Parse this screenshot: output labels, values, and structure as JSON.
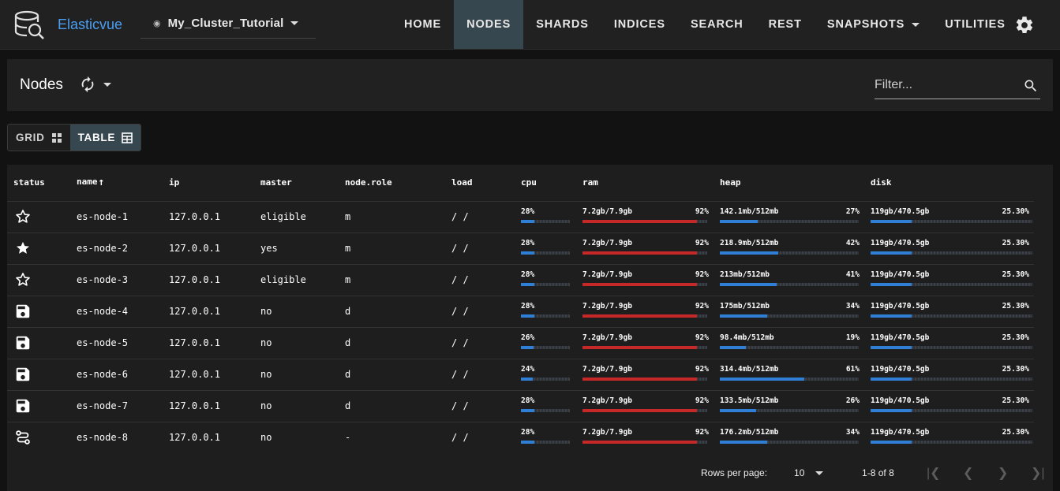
{
  "app": {
    "brand": "Elasticvue",
    "cluster_name": "My_Cluster_Tutorial",
    "accent_color": "#4a9ef2"
  },
  "nav": {
    "home": "HOME",
    "nodes": "NODES",
    "shards": "SHARDS",
    "indices": "INDICES",
    "search": "SEARCH",
    "rest": "REST",
    "snapshots": "SNAPSHOTS",
    "utilities": "UTILITIES",
    "active": "NODES",
    "settings_icon": "gear-icon"
  },
  "page": {
    "title": "Nodes",
    "filter_placeholder": "Filter..."
  },
  "view_toggle": {
    "grid": "GRID",
    "table": "TABLE",
    "active": "TABLE"
  },
  "table": {
    "columns": {
      "status": "status",
      "name": "name",
      "ip": "ip",
      "master": "master",
      "node_role": "node.role",
      "load": "load",
      "cpu": "cpu",
      "ram": "ram",
      "heap": "heap",
      "disk": "disk"
    },
    "sort": {
      "column": "name",
      "direction": "ascending"
    },
    "rows": [
      {
        "status_icon": "star-outline-icon",
        "name": "es-node-1",
        "ip": "127.0.0.1",
        "master": "eligible",
        "role": "m",
        "load": "/ /",
        "cpu": "28%",
        "cpu_pct": 28,
        "ram": "7.2gb/7.9gb",
        "ram_pct_label": "92%",
        "ram_pct": 92,
        "heap": "142.1mb/512mb",
        "heap_pct_label": "27%",
        "heap_pct": 27,
        "disk": "119gb/470.5gb",
        "disk_pct_label": "25.30%",
        "disk_pct": 25.3
      },
      {
        "status_icon": "star-filled-icon",
        "name": "es-node-2",
        "ip": "127.0.0.1",
        "master": "yes",
        "role": "m",
        "load": "/ /",
        "cpu": "28%",
        "cpu_pct": 28,
        "ram": "7.2gb/7.9gb",
        "ram_pct_label": "92%",
        "ram_pct": 92,
        "heap": "218.9mb/512mb",
        "heap_pct_label": "42%",
        "heap_pct": 42,
        "disk": "119gb/470.5gb",
        "disk_pct_label": "25.30%",
        "disk_pct": 25.3
      },
      {
        "status_icon": "star-outline-icon",
        "name": "es-node-3",
        "ip": "127.0.0.1",
        "master": "eligible",
        "role": "m",
        "load": "/ /",
        "cpu": "28%",
        "cpu_pct": 28,
        "ram": "7.2gb/7.9gb",
        "ram_pct_label": "92%",
        "ram_pct": 92,
        "heap": "213mb/512mb",
        "heap_pct_label": "41%",
        "heap_pct": 41,
        "disk": "119gb/470.5gb",
        "disk_pct_label": "25.30%",
        "disk_pct": 25.3
      },
      {
        "status_icon": "floppy-disk-icon",
        "name": "es-node-4",
        "ip": "127.0.0.1",
        "master": "no",
        "role": "d",
        "load": "/ /",
        "cpu": "28%",
        "cpu_pct": 28,
        "ram": "7.2gb/7.9gb",
        "ram_pct_label": "92%",
        "ram_pct": 92,
        "heap": "175mb/512mb",
        "heap_pct_label": "34%",
        "heap_pct": 34,
        "disk": "119gb/470.5gb",
        "disk_pct_label": "25.30%",
        "disk_pct": 25.3
      },
      {
        "status_icon": "floppy-disk-icon",
        "name": "es-node-5",
        "ip": "127.0.0.1",
        "master": "no",
        "role": "d",
        "load": "/ /",
        "cpu": "26%",
        "cpu_pct": 26,
        "ram": "7.2gb/7.9gb",
        "ram_pct_label": "92%",
        "ram_pct": 92,
        "heap": "98.4mb/512mb",
        "heap_pct_label": "19%",
        "heap_pct": 19,
        "disk": "119gb/470.5gb",
        "disk_pct_label": "25.30%",
        "disk_pct": 25.3
      },
      {
        "status_icon": "floppy-disk-icon",
        "name": "es-node-6",
        "ip": "127.0.0.1",
        "master": "no",
        "role": "d",
        "load": "/ /",
        "cpu": "24%",
        "cpu_pct": 24,
        "ram": "7.2gb/7.9gb",
        "ram_pct_label": "92%",
        "ram_pct": 92,
        "heap": "314.4mb/512mb",
        "heap_pct_label": "61%",
        "heap_pct": 61,
        "disk": "119gb/470.5gb",
        "disk_pct_label": "25.30%",
        "disk_pct": 25.3
      },
      {
        "status_icon": "floppy-disk-icon",
        "name": "es-node-7",
        "ip": "127.0.0.1",
        "master": "no",
        "role": "d",
        "load": "/ /",
        "cpu": "28%",
        "cpu_pct": 28,
        "ram": "7.2gb/7.9gb",
        "ram_pct_label": "92%",
        "ram_pct": 92,
        "heap": "133.5mb/512mb",
        "heap_pct_label": "26%",
        "heap_pct": 26,
        "disk": "119gb/470.5gb",
        "disk_pct_label": "25.30%",
        "disk_pct": 25.3
      },
      {
        "status_icon": "route-icon",
        "name": "es-node-8",
        "ip": "127.0.0.1",
        "master": "no",
        "role": "-",
        "load": "/ /",
        "cpu": "28%",
        "cpu_pct": 28,
        "ram": "7.2gb/7.9gb",
        "ram_pct_label": "92%",
        "ram_pct": 92,
        "heap": "176.2mb/512mb",
        "heap_pct_label": "34%",
        "heap_pct": 34,
        "disk": "119gb/470.5gb",
        "disk_pct_label": "25.30%",
        "disk_pct": 25.3
      }
    ]
  },
  "footer": {
    "rows_per_page_label": "Rows per page:",
    "rows_per_page_value": "10",
    "range": "1-8 of 8"
  },
  "colors": {
    "bar_blue": "#2f7fd6",
    "bar_red": "#c62828",
    "active_nav_bg": "#37474f"
  }
}
